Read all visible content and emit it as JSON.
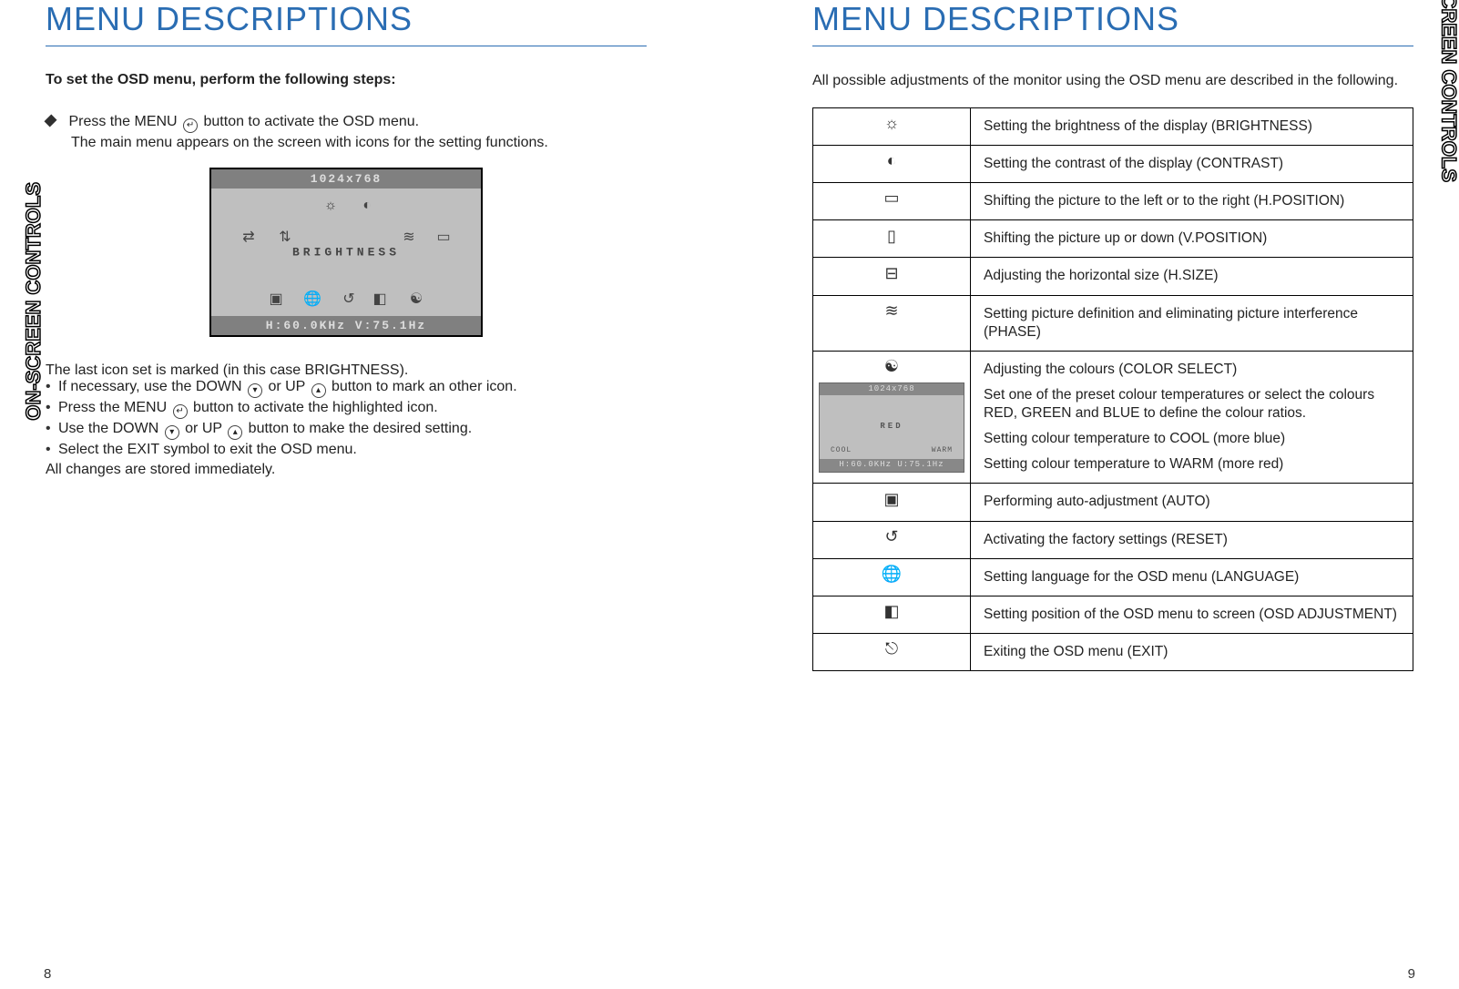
{
  "sideTab": "ON-SCREEN CONTROLS",
  "left": {
    "heading": "MENU DESCRIPTIONS",
    "leadBold": "To set the OSD menu, perform the following steps:",
    "step1a": "Press the MENU",
    "step1b": "button to activate the OSD menu.",
    "step1sub": "The main menu appears on the screen with icons for the setting functions.",
    "osdTop": "1024x768",
    "osdCenter": "BRIGHTNESS",
    "osdBottom": "H:60.0KHz V:75.1Hz",
    "afterShot": "The last icon set  is marked (in this case BRIGHTNESS).",
    "b1a": "If necessary, use the DOWN",
    "b1b": "or UP",
    "b1c": "button to mark an other icon.",
    "b2a": "Press the MENU",
    "b2b": "button to activate the highlighted icon.",
    "b3a": "Use the DOWN",
    "b3b": "or UP",
    "b3c": "button to make the desired setting.",
    "b4": "Select the EXIT symbol to exit the OSD menu.",
    "tail": "All changes are stored immediately.",
    "pageNum": "8"
  },
  "right": {
    "heading": "MENU DESCRIPTIONS",
    "intro": "All possible adjustments of the monitor using the OSD menu are described in the following.",
    "rows": {
      "r0": "Setting the brightness of the display (BRIGHTNESS)",
      "r1": "Setting the contrast of the display (CONTRAST)",
      "r2": "Shifting the picture to the left or to the right (H.POSITION)",
      "r3": "Shifting the picture up or down (V.POSITION)",
      "r4": "Adjusting the horizontal size (H.SIZE)",
      "r5": "Setting picture definition and eliminating picture interference (PHASE)",
      "r6title": "Adjusting the colours (COLOR SELECT)",
      "r6p1": "Set one of the preset colour temperatures or select the colours RED, GREEN and BLUE to define the colour ratios.",
      "r6p2": "Setting colour temperature to COOL (more blue)",
      "r6p3": "Setting colour temperature to WARM (more red)",
      "r7": "Performing auto-adjustment (AUTO)",
      "r8": "Activating the factory settings (RESET)",
      "r9": "Setting language for the OSD menu (LANGUAGE)",
      "r10": "Setting position of the OSD menu to screen (OSD ADJUSTMENT)",
      "r11": "Exiting the OSD menu (EXIT)"
    },
    "miniOsd": {
      "top": "1024x768",
      "center": "RED",
      "cool": "COOL",
      "warm": "WARM",
      "bottom": "H:60.0KHz U:75.1Hz"
    },
    "pageNum": "9"
  }
}
